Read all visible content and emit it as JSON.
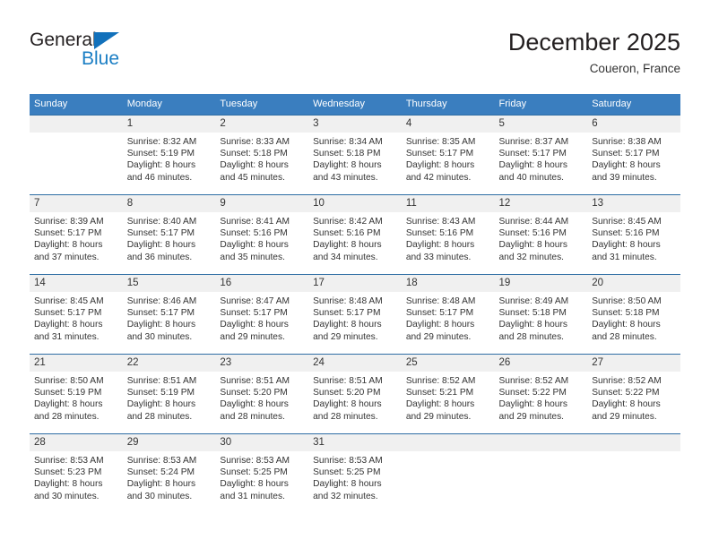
{
  "brand": {
    "name_part1": "General",
    "name_part2": "Blue",
    "triangle_icon": "triangle-icon",
    "accent_color": "#1a7ec4"
  },
  "header": {
    "title": "December 2025",
    "location": "Coueron, France"
  },
  "colors": {
    "header_blue": "#3a7ebf",
    "row_divider": "#2e6da4",
    "daynum_band": "#f0f0f0"
  },
  "weekday_headers": [
    "Sunday",
    "Monday",
    "Tuesday",
    "Wednesday",
    "Thursday",
    "Friday",
    "Saturday"
  ],
  "labels": {
    "sunrise_prefix": "Sunrise:",
    "sunset_prefix": "Sunset:",
    "daylight_prefix": "Daylight:"
  },
  "weeks": [
    [
      {
        "day": "",
        "empty": true,
        "line1": "",
        "line2": "",
        "line3": "",
        "line4": ""
      },
      {
        "day": "1",
        "line1": "Sunrise: 8:32 AM",
        "line2": "Sunset: 5:19 PM",
        "line3": "Daylight: 8 hours",
        "line4": "and 46 minutes."
      },
      {
        "day": "2",
        "line1": "Sunrise: 8:33 AM",
        "line2": "Sunset: 5:18 PM",
        "line3": "Daylight: 8 hours",
        "line4": "and 45 minutes."
      },
      {
        "day": "3",
        "line1": "Sunrise: 8:34 AM",
        "line2": "Sunset: 5:18 PM",
        "line3": "Daylight: 8 hours",
        "line4": "and 43 minutes."
      },
      {
        "day": "4",
        "line1": "Sunrise: 8:35 AM",
        "line2": "Sunset: 5:17 PM",
        "line3": "Daylight: 8 hours",
        "line4": "and 42 minutes."
      },
      {
        "day": "5",
        "line1": "Sunrise: 8:37 AM",
        "line2": "Sunset: 5:17 PM",
        "line3": "Daylight: 8 hours",
        "line4": "and 40 minutes."
      },
      {
        "day": "6",
        "line1": "Sunrise: 8:38 AM",
        "line2": "Sunset: 5:17 PM",
        "line3": "Daylight: 8 hours",
        "line4": "and 39 minutes."
      }
    ],
    [
      {
        "day": "7",
        "line1": "Sunrise: 8:39 AM",
        "line2": "Sunset: 5:17 PM",
        "line3": "Daylight: 8 hours",
        "line4": "and 37 minutes."
      },
      {
        "day": "8",
        "line1": "Sunrise: 8:40 AM",
        "line2": "Sunset: 5:17 PM",
        "line3": "Daylight: 8 hours",
        "line4": "and 36 minutes."
      },
      {
        "day": "9",
        "line1": "Sunrise: 8:41 AM",
        "line2": "Sunset: 5:16 PM",
        "line3": "Daylight: 8 hours",
        "line4": "and 35 minutes."
      },
      {
        "day": "10",
        "line1": "Sunrise: 8:42 AM",
        "line2": "Sunset: 5:16 PM",
        "line3": "Daylight: 8 hours",
        "line4": "and 34 minutes."
      },
      {
        "day": "11",
        "line1": "Sunrise: 8:43 AM",
        "line2": "Sunset: 5:16 PM",
        "line3": "Daylight: 8 hours",
        "line4": "and 33 minutes."
      },
      {
        "day": "12",
        "line1": "Sunrise: 8:44 AM",
        "line2": "Sunset: 5:16 PM",
        "line3": "Daylight: 8 hours",
        "line4": "and 32 minutes."
      },
      {
        "day": "13",
        "line1": "Sunrise: 8:45 AM",
        "line2": "Sunset: 5:16 PM",
        "line3": "Daylight: 8 hours",
        "line4": "and 31 minutes."
      }
    ],
    [
      {
        "day": "14",
        "line1": "Sunrise: 8:45 AM",
        "line2": "Sunset: 5:17 PM",
        "line3": "Daylight: 8 hours",
        "line4": "and 31 minutes."
      },
      {
        "day": "15",
        "line1": "Sunrise: 8:46 AM",
        "line2": "Sunset: 5:17 PM",
        "line3": "Daylight: 8 hours",
        "line4": "and 30 minutes."
      },
      {
        "day": "16",
        "line1": "Sunrise: 8:47 AM",
        "line2": "Sunset: 5:17 PM",
        "line3": "Daylight: 8 hours",
        "line4": "and 29 minutes."
      },
      {
        "day": "17",
        "line1": "Sunrise: 8:48 AM",
        "line2": "Sunset: 5:17 PM",
        "line3": "Daylight: 8 hours",
        "line4": "and 29 minutes."
      },
      {
        "day": "18",
        "line1": "Sunrise: 8:48 AM",
        "line2": "Sunset: 5:17 PM",
        "line3": "Daylight: 8 hours",
        "line4": "and 29 minutes."
      },
      {
        "day": "19",
        "line1": "Sunrise: 8:49 AM",
        "line2": "Sunset: 5:18 PM",
        "line3": "Daylight: 8 hours",
        "line4": "and 28 minutes."
      },
      {
        "day": "20",
        "line1": "Sunrise: 8:50 AM",
        "line2": "Sunset: 5:18 PM",
        "line3": "Daylight: 8 hours",
        "line4": "and 28 minutes."
      }
    ],
    [
      {
        "day": "21",
        "line1": "Sunrise: 8:50 AM",
        "line2": "Sunset: 5:19 PM",
        "line3": "Daylight: 8 hours",
        "line4": "and 28 minutes."
      },
      {
        "day": "22",
        "line1": "Sunrise: 8:51 AM",
        "line2": "Sunset: 5:19 PM",
        "line3": "Daylight: 8 hours",
        "line4": "and 28 minutes."
      },
      {
        "day": "23",
        "line1": "Sunrise: 8:51 AM",
        "line2": "Sunset: 5:20 PM",
        "line3": "Daylight: 8 hours",
        "line4": "and 28 minutes."
      },
      {
        "day": "24",
        "line1": "Sunrise: 8:51 AM",
        "line2": "Sunset: 5:20 PM",
        "line3": "Daylight: 8 hours",
        "line4": "and 28 minutes."
      },
      {
        "day": "25",
        "line1": "Sunrise: 8:52 AM",
        "line2": "Sunset: 5:21 PM",
        "line3": "Daylight: 8 hours",
        "line4": "and 29 minutes."
      },
      {
        "day": "26",
        "line1": "Sunrise: 8:52 AM",
        "line2": "Sunset: 5:22 PM",
        "line3": "Daylight: 8 hours",
        "line4": "and 29 minutes."
      },
      {
        "day": "27",
        "line1": "Sunrise: 8:52 AM",
        "line2": "Sunset: 5:22 PM",
        "line3": "Daylight: 8 hours",
        "line4": "and 29 minutes."
      }
    ],
    [
      {
        "day": "28",
        "line1": "Sunrise: 8:53 AM",
        "line2": "Sunset: 5:23 PM",
        "line3": "Daylight: 8 hours",
        "line4": "and 30 minutes."
      },
      {
        "day": "29",
        "line1": "Sunrise: 8:53 AM",
        "line2": "Sunset: 5:24 PM",
        "line3": "Daylight: 8 hours",
        "line4": "and 30 minutes."
      },
      {
        "day": "30",
        "line1": "Sunrise: 8:53 AM",
        "line2": "Sunset: 5:25 PM",
        "line3": "Daylight: 8 hours",
        "line4": "and 31 minutes."
      },
      {
        "day": "31",
        "line1": "Sunrise: 8:53 AM",
        "line2": "Sunset: 5:25 PM",
        "line3": "Daylight: 8 hours",
        "line4": "and 32 minutes."
      },
      {
        "day": "",
        "empty": true,
        "line1": "",
        "line2": "",
        "line3": "",
        "line4": ""
      },
      {
        "day": "",
        "empty": true,
        "line1": "",
        "line2": "",
        "line3": "",
        "line4": ""
      },
      {
        "day": "",
        "empty": true,
        "line1": "",
        "line2": "",
        "line3": "",
        "line4": ""
      }
    ]
  ]
}
